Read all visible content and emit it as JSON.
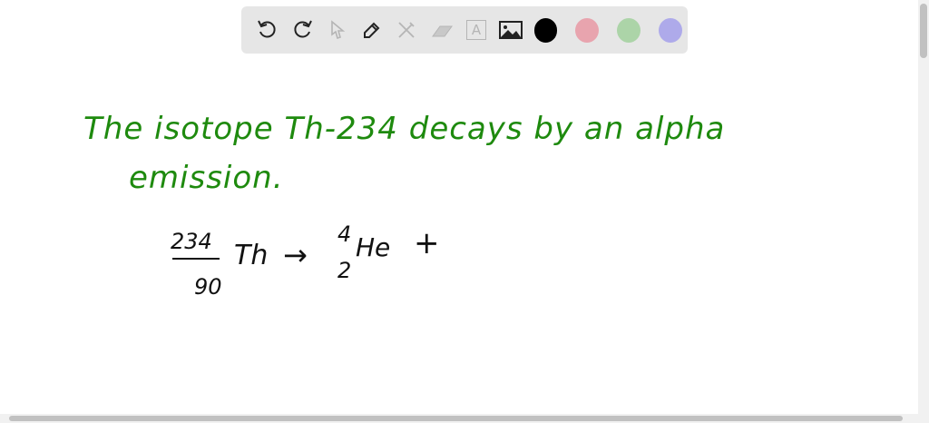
{
  "toolbar": {
    "tools": [
      "undo-icon",
      "redo-icon",
      "select-icon",
      "pen-icon",
      "tools-icon",
      "eraser-icon",
      "text-icon",
      "image-icon"
    ],
    "text_tool_glyph": "A",
    "colors": [
      "#000000",
      "#e8a4ae",
      "#acd4a8",
      "#aeaaea"
    ]
  },
  "canvas": {
    "line1": "The isotope Th-234 decays by an alpha",
    "line2": "emission.",
    "eq": {
      "mass": "234",
      "atomic": "90",
      "symbol": "Th",
      "arrow": "→",
      "he_mass": "4",
      "he_atomic": "2",
      "he_symbol": "He",
      "plus": "+"
    },
    "ink_color": "#1e8a0e"
  }
}
